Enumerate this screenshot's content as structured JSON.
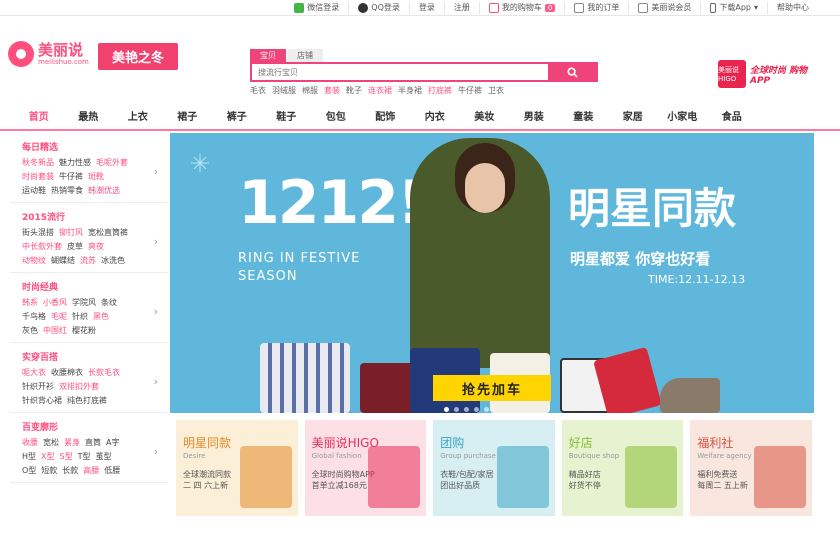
{
  "topbar": {
    "wechat": "微信登录",
    "qq": "QQ登录",
    "login": "登录",
    "register": "注册",
    "cart": "我的购物车",
    "cart_count": "0",
    "orders": "我的订单",
    "member": "美丽说会员",
    "app": "下载App",
    "help": "帮助中心"
  },
  "logo": {
    "name": "美丽说",
    "domain": "meilishuo.com"
  },
  "promo": {
    "label": "美艳之冬"
  },
  "search": {
    "tabs": [
      "宝贝",
      "店铺"
    ],
    "placeholder": "搜流行宝贝",
    "hot": [
      {
        "t": "毛衣",
        "pink": false
      },
      {
        "t": "羽绒服",
        "pink": false
      },
      {
        "t": "棉服",
        "pink": false
      },
      {
        "t": "套装",
        "pink": true
      },
      {
        "t": "靴子",
        "pink": false
      },
      {
        "t": "连衣裙",
        "pink": true
      },
      {
        "t": "半身裙",
        "pink": false
      },
      {
        "t": "打底裤",
        "pink": true
      },
      {
        "t": "牛仔裤",
        "pink": false
      },
      {
        "t": "卫衣",
        "pink": false
      }
    ]
  },
  "higo": {
    "box": "美丽说 HIGO",
    "slogan": "全球时尚 购物APP"
  },
  "nav": [
    "首页",
    "最热",
    "上衣",
    "裙子",
    "裤子",
    "鞋子",
    "包包",
    "配饰",
    "内衣",
    "美妆",
    "男装",
    "童装",
    "家居",
    "小家电",
    "食品"
  ],
  "side": [
    {
      "title": "每日精选",
      "rows": [
        [
          {
            "t": "秋冬新品",
            "p": true
          },
          {
            "t": "魅力性感",
            "p": false
          },
          {
            "t": "毛呢外套",
            "p": true
          }
        ],
        [
          {
            "t": "时尚套装",
            "p": true
          },
          {
            "t": "牛仔裤",
            "p": false
          },
          {
            "t": "斑靴",
            "p": true
          }
        ],
        [
          {
            "t": "运动鞋",
            "p": false
          },
          {
            "t": "热销零食",
            "p": false
          },
          {
            "t": "韩潮优选",
            "p": true
          }
        ]
      ]
    },
    {
      "title": "2015流行",
      "rows": [
        [
          {
            "t": "街头混搭",
            "p": false
          },
          {
            "t": "铆钉风",
            "p": true
          },
          {
            "t": "宽松直筒裤",
            "p": false
          }
        ],
        [
          {
            "t": "中长款外套",
            "p": true
          },
          {
            "t": "皮草",
            "p": false
          },
          {
            "t": "爽夜",
            "p": true
          }
        ],
        [
          {
            "t": "动物纹",
            "p": true
          },
          {
            "t": "蝴蝶结",
            "p": false
          },
          {
            "t": "流苏",
            "p": true
          },
          {
            "t": "冰洗色",
            "p": false
          }
        ]
      ]
    },
    {
      "title": "时尚经典",
      "rows": [
        [
          {
            "t": "韩系",
            "p": true
          },
          {
            "t": "小香风",
            "p": true
          },
          {
            "t": "学院风",
            "p": false
          },
          {
            "t": "条纹",
            "p": false
          }
        ],
        [
          {
            "t": "千鸟格",
            "p": false
          },
          {
            "t": "毛呢",
            "p": true
          },
          {
            "t": "针织",
            "p": false
          },
          {
            "t": "黑色",
            "p": true
          }
        ],
        [
          {
            "t": "灰色",
            "p": false
          },
          {
            "t": "中国红",
            "p": true
          },
          {
            "t": "樱花粉",
            "p": false
          }
        ]
      ]
    },
    {
      "title": "实穿百搭",
      "rows": [
        [
          {
            "t": "呢大衣",
            "p": true
          },
          {
            "t": "收腰棉衣",
            "p": false
          },
          {
            "t": "长款毛衣",
            "p": true
          }
        ],
        [
          {
            "t": "针织开衫",
            "p": false
          },
          {
            "t": "双排扣外套",
            "p": true
          }
        ],
        [
          {
            "t": "针织背心裙",
            "p": false
          },
          {
            "t": "纯色打底裤",
            "p": false
          }
        ]
      ]
    },
    {
      "title": "百变廓形",
      "rows": [
        [
          {
            "t": "收腰",
            "p": true
          },
          {
            "t": "宽松",
            "p": false
          },
          {
            "t": "紧身",
            "p": true
          },
          {
            "t": "直筒",
            "p": false
          },
          {
            "t": "A字",
            "p": false
          }
        ],
        [
          {
            "t": "H型",
            "p": false
          },
          {
            "t": "X型",
            "p": true
          },
          {
            "t": "S型",
            "p": true
          },
          {
            "t": "T型",
            "p": false
          },
          {
            "t": "茧型",
            "p": false
          }
        ],
        [
          {
            "t": "O型",
            "p": false
          },
          {
            "t": "短款",
            "p": false
          },
          {
            "t": "长款",
            "p": false
          },
          {
            "t": "高腰",
            "p": true
          },
          {
            "t": "低腰",
            "p": false
          }
        ]
      ]
    }
  ],
  "banner": {
    "big": "1212!",
    "ring1": "RING IN FESTIVE",
    "ring2": "SEASON",
    "star": "明星同款",
    "tag": "明星都爱 你穿也好看",
    "time": "TIME:12.11-12.13",
    "cta": "抢先加车"
  },
  "tiles": [
    {
      "title": "明星同款",
      "en": "Desire",
      "d1": "全球潮流同款",
      "d2": "二 四 六上新",
      "bg": "#fbefd8",
      "color": "#e88a2a"
    },
    {
      "title": "美丽说HIGO",
      "en": "Global fashion",
      "d1": "全球时尚购物APP",
      "d2": "首单立减168元",
      "bg": "#fde0e6",
      "color": "#e8305a"
    },
    {
      "title": "团购",
      "en": "Group purchase",
      "d1": "衣鞋/包配/家居",
      "d2": "团出好品质",
      "bg": "#d7eef3",
      "color": "#3aa6c2"
    },
    {
      "title": "好店",
      "en": "Boutique shop",
      "d1": "精品好店",
      "d2": "好货不停",
      "bg": "#e6f2d0",
      "color": "#88bf33"
    },
    {
      "title": "福利社",
      "en": "Welfare agency",
      "d1": "福利免费送",
      "d2": "每周二 五上新",
      "bg": "#f8e6df",
      "color": "#d9533e"
    }
  ]
}
